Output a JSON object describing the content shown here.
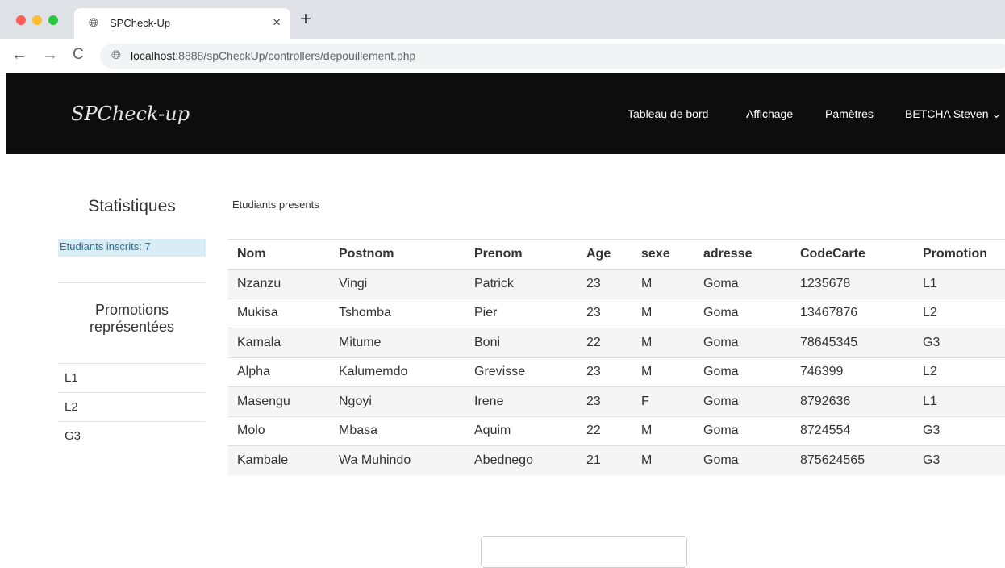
{
  "browser": {
    "tab_title": "SPCheck-Up",
    "tab_close": "×",
    "new_tab": "+",
    "url_host": "localhost",
    "url_rest": ":8888/spCheckUp/controllers/depouillement.php"
  },
  "navbar": {
    "brand": "SPCheck-up",
    "items": [
      "Tableau de bord",
      "Affichage",
      "Pamètres",
      "BETCHA Steven"
    ]
  },
  "sidebar": {
    "title": "Statistiques",
    "inscrits": "Etudiants inscrits: 7",
    "promotions_title_line1": "Promotions",
    "promotions_title_line2": "représentées",
    "promotions": [
      "L1",
      "L2",
      "G3"
    ]
  },
  "main": {
    "label": "Etudiants presents",
    "columns": [
      "Nom",
      "Postnom",
      "Prenom",
      "Age",
      "sexe",
      "adresse",
      "CodeCarte",
      "Promotion"
    ],
    "rows": [
      [
        "Nzanzu",
        "Vingi",
        "Patrick",
        "23",
        "M",
        "Goma",
        "1235678",
        "L1"
      ],
      [
        "Mukisa",
        "Tshomba",
        "Pier",
        "23",
        "M",
        "Goma",
        "13467876",
        "L2"
      ],
      [
        "Kamala",
        "Mitume",
        "Boni",
        "22",
        "M",
        "Goma",
        "78645345",
        "G3"
      ],
      [
        "Alpha",
        "Kalumemdo",
        "Grevisse",
        "23",
        "M",
        "Goma",
        "746399",
        "L2"
      ],
      [
        "Masengu",
        "Ngoyi",
        "Irene",
        "23",
        "F",
        "Goma",
        "8792636",
        "L1"
      ],
      [
        "Molo",
        "Mbasa",
        "Aquim",
        "22",
        "M",
        "Goma",
        "8724554",
        "G3"
      ],
      [
        "Kambale",
        "Wa Muhindo",
        "Abednego",
        "21",
        "M",
        "Goma",
        "875624565",
        "G3"
      ]
    ]
  },
  "icons": {
    "tab": "globe-icon",
    "back": "arrow-left-icon",
    "forward": "arrow-right-icon",
    "reload": "reload-icon",
    "site": "site-info-icon",
    "dropdown": "chevron-down-icon"
  },
  "colors": {
    "navbar_bg": "#0d0d0d",
    "info_bg": "#d9edf7",
    "info_text": "#31708f"
  }
}
